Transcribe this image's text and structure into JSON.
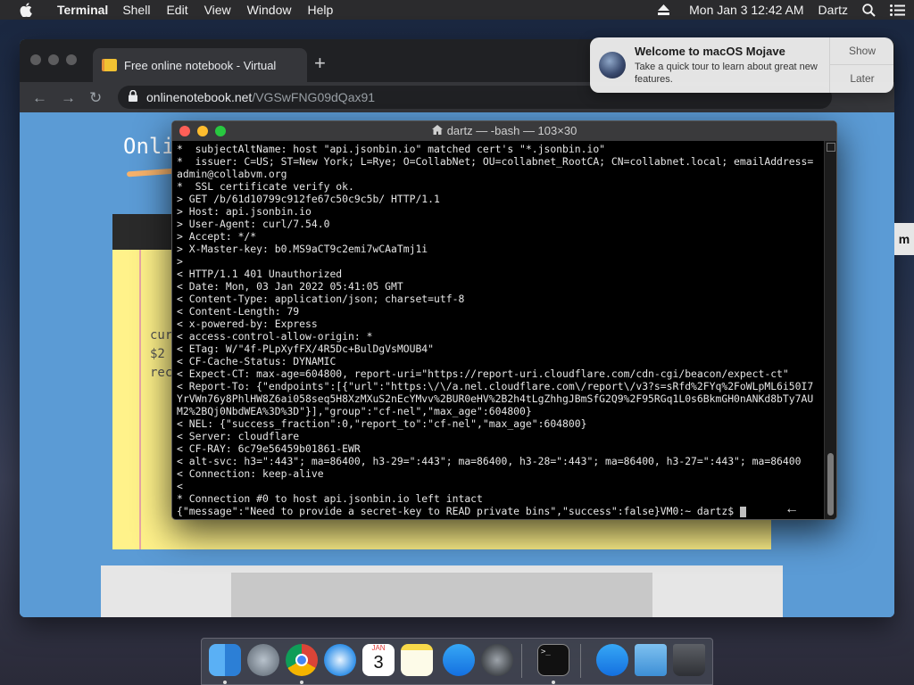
{
  "menubar": {
    "app_name": "Terminal",
    "menus": [
      "Shell",
      "Edit",
      "View",
      "Window",
      "Help"
    ],
    "clock": "Mon Jan 3  12:42 AM",
    "user": "Dartz"
  },
  "browser": {
    "tab_title": "Free online notebook - Virtual",
    "new_tab": "+",
    "url_host": "onlinenotebook.net",
    "url_path": "/VGSwFNG09dQax91",
    "page_title_partial": "Onli",
    "notebook_lines": [
      "cur",
      "$2",
      "rec"
    ]
  },
  "notification": {
    "title": "Welcome to macOS Mojave",
    "body": "Take a quick tour to learn about great new features.",
    "show_label": "Show",
    "later_label": "Later"
  },
  "terminal": {
    "window_title": "dartz — -bash — 103×30",
    "lines": [
      "*  subjectAltName: host \"api.jsonbin.io\" matched cert's \"*.jsonbin.io\"",
      "*  issuer: C=US; ST=New York; L=Rye; O=CollabNet; OU=collabnet_RootCA; CN=collabnet.local; emailAddress=admin@collabvm.org",
      "*  SSL certificate verify ok.",
      "> GET /b/61d10799c912fe67c50c9c5b/ HTTP/1.1",
      "> Host: api.jsonbin.io",
      "> User-Agent: curl/7.54.0",
      "> Accept: */*",
      "> X-Master-key: b0.MS9aCT9c2emi7wCAaTmj1i",
      ">",
      "< HTTP/1.1 401 Unauthorized",
      "< Date: Mon, 03 Jan 2022 05:41:05 GMT",
      "< Content-Type: application/json; charset=utf-8",
      "< Content-Length: 79",
      "< x-powered-by: Express",
      "< access-control-allow-origin: *",
      "< ETag: W/\"4f-PLpXyfFX/4R5Dc+BulDgVsMOUB4\"",
      "< CF-Cache-Status: DYNAMIC",
      "< Expect-CT: max-age=604800, report-uri=\"https://report-uri.cloudflare.com/cdn-cgi/beacon/expect-ct\"",
      "< Report-To: {\"endpoints\":[{\"url\":\"https:\\/\\/a.nel.cloudflare.com\\/report\\/v3?s=sRfd%2FYq%2FoWLpML6i50I7YrVWn76y8PhlHW8Z6ai058seq5H8XzMXuS2nEcYMvv%2BUR0eHV%2B2h4tLgZhhgJBmSfG2Q9%2F95RGq1L0s6BkmGH0nANKd8bTy7AUM2%2BQj0NbdWEA%3D%3D\"}],\"group\":\"cf-nel\",\"max_age\":604800}",
      "< NEL: {\"success_fraction\":0,\"report_to\":\"cf-nel\",\"max_age\":604800}",
      "< Server: cloudflare",
      "< CF-RAY: 6c79e56459b01861-EWR",
      "< alt-svc: h3=\":443\"; ma=86400, h3-29=\":443\"; ma=86400, h3-28=\":443\"; ma=86400, h3-27=\":443\"; ma=86400",
      "< Connection: keep-alive",
      "<",
      "* Connection #0 to host api.jsonbin.io left intact"
    ],
    "last_line": "{\"message\":\"Need to provide a secret-key to READ private bins\",\"success\":false}VM0:~ dartz$ "
  },
  "edge_tab": "m",
  "dock": {
    "apps": [
      "finder",
      "launchpad",
      "chrome",
      "safari",
      "calendar",
      "notes",
      "app-store",
      "system-preferences",
      "terminal",
      "app-store-2",
      "downloads",
      "trash"
    ],
    "calendar_month": "JAN",
    "calendar_day": "3"
  },
  "colors": {
    "page_blue": "#5b9bd5",
    "notebook_yellow": "#fff28a",
    "terminal_bg": "#000000",
    "close": "#ff5f57",
    "minimize": "#febc2e",
    "zoom": "#28c840"
  }
}
